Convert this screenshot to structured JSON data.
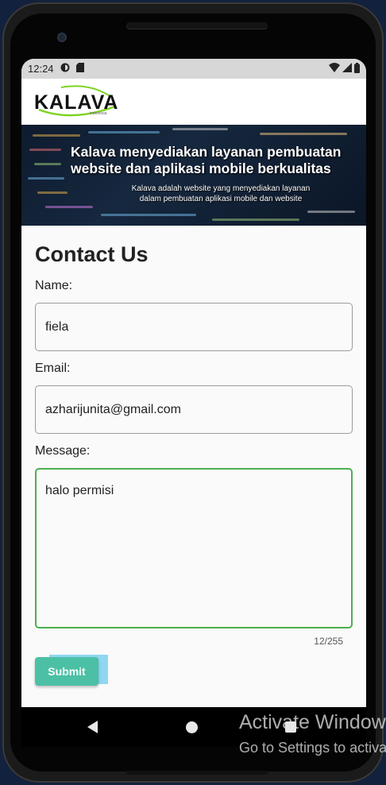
{
  "status_bar": {
    "time": "12:24",
    "left_icons": [
      "sync-icon",
      "sd-card-icon"
    ],
    "right_icons": [
      "wifi-icon",
      "signal-icon",
      "battery-icon"
    ]
  },
  "header": {
    "logo_text": "KALAVA",
    "logo_sub": "indonesia"
  },
  "banner": {
    "title": "Kalava menyediakan layanan pembuatan website  dan aplikasi mobile berkualitas",
    "subtitle": "Kalava adalah website yang menyediakan layanan dalam pembuatan aplikasi mobile  dan website"
  },
  "page": {
    "title": "Contact Us"
  },
  "form": {
    "name_label": "Name:",
    "name_value": "fiela",
    "email_label": "Email:",
    "email_value": "azharijunita@gmail.com",
    "message_label": "Message:",
    "message_value": "halo permisi",
    "counter": "12/255",
    "submit_label": "Submit"
  },
  "colors": {
    "accent_green": "#4caf50",
    "submit_bg": "#4bc0a5",
    "logo_swoosh": "#7ed321"
  },
  "watermark": {
    "line1": "Activate Windows",
    "line2": "Go to Settings to activate Windows."
  }
}
